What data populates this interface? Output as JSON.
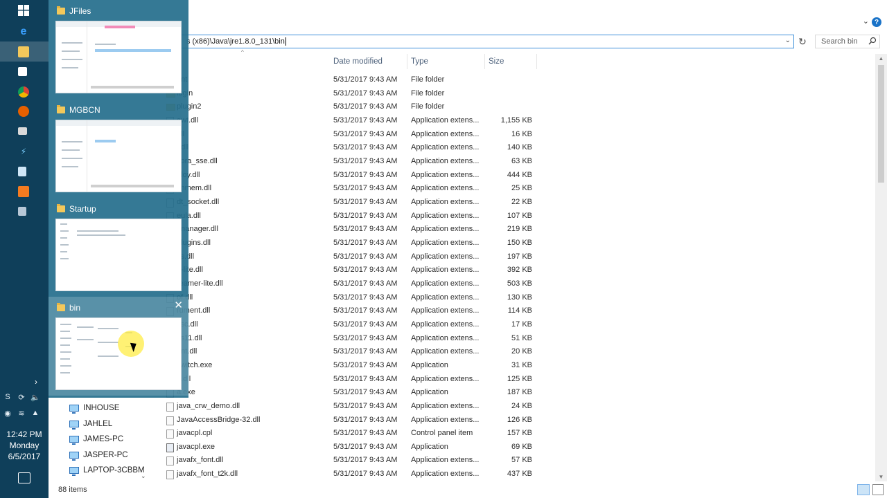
{
  "taskbar": {
    "icons": [
      "windows-start-icon",
      "edge-icon",
      "file-explorer-icon",
      "store-icon",
      "chrome-icon",
      "firefox-icon",
      "terminal-icon",
      "app-icon",
      "notepad-icon",
      "office-icon",
      "tool-icon"
    ],
    "clock": {
      "time": "12:42 PM",
      "day": "Monday",
      "date": "6/5/2017"
    }
  },
  "switcher": {
    "windows": [
      {
        "title": "JFiles"
      },
      {
        "title": "MGBCN"
      },
      {
        "title": "Startup"
      },
      {
        "title": "bin"
      }
    ],
    "close_glyph": "✕"
  },
  "explorer": {
    "address": "s (x86)\\Java\\jre1.8.0_131\\bin",
    "search_placeholder": "Search bin",
    "columns": {
      "date": "Date modified",
      "type": "Type",
      "size": "Size"
    },
    "files": [
      {
        "name": "ent",
        "date": "5/31/2017 9:43 AM",
        "type": "File folder",
        "size": ""
      },
      {
        "name": "lugin",
        "date": "5/31/2017 9:43 AM",
        "type": "File folder",
        "size": ""
      },
      {
        "name": "plugin2",
        "date": "5/31/2017 9:43 AM",
        "type": "File folder",
        "size": ""
      },
      {
        "name": "awt.dll",
        "date": "5/31/2017 9:43 AM",
        "type": "Application extens...",
        "size": "1,155 KB"
      },
      {
        "name": "dll",
        "date": "5/31/2017 9:43 AM",
        "type": "Application extens...",
        "size": "16 KB"
      },
      {
        "name": "r.dll",
        "date": "5/31/2017 9:43 AM",
        "type": "Application extens...",
        "size": "140 KB"
      },
      {
        "name": "cora_sse.dll",
        "date": "5/31/2017 9:43 AM",
        "type": "Application extens...",
        "size": "63 KB"
      },
      {
        "name": "ploy.dll",
        "date": "5/31/2017 9:43 AM",
        "type": "Application extens...",
        "size": "444 KB"
      },
      {
        "name": "shmem.dll",
        "date": "5/31/2017 9:43 AM",
        "type": "Application extens...",
        "size": "25 KB"
      },
      {
        "name": "dt_socket.dll",
        "date": "5/31/2017 9:43 AM",
        "type": "Application extens...",
        "size": "22 KB"
      },
      {
        "name": "eula.dll",
        "date": "5/31/2017 9:43 AM",
        "type": "Application extens...",
        "size": "107 KB"
      },
      {
        "name": "tmanager.dll",
        "date": "5/31/2017 9:43 AM",
        "type": "Application extens...",
        "size": "219 KB"
      },
      {
        "name": "plugins.dll",
        "date": "5/31/2017 9:43 AM",
        "type": "Application extens...",
        "size": "150 KB"
      },
      {
        "name": "ss.dll",
        "date": "5/31/2017 9:43 AM",
        "type": "Application extens...",
        "size": "197 KB"
      },
      {
        "name": "o-lite.dll",
        "date": "5/31/2017 9:43 AM",
        "type": "Application extens...",
        "size": "392 KB"
      },
      {
        "name": "reamer-lite.dll",
        "date": "5/31/2017 9:43 AM",
        "type": "Application extens...",
        "size": "503 KB"
      },
      {
        "name": "of.dll",
        "date": "5/31/2017 9:43 AM",
        "type": "Application extens...",
        "size": "130 KB"
      },
      {
        "name": "rument.dll",
        "date": "5/31/2017 9:43 AM",
        "type": "Application extens...",
        "size": "114 KB"
      },
      {
        "name": "csc.dll",
        "date": "5/31/2017 9:43 AM",
        "type": "Application extens...",
        "size": "17 KB"
      },
      {
        "name": "cs11.dll",
        "date": "5/31/2017 9:43 AM",
        "type": "Application extens...",
        "size": "51 KB"
      },
      {
        "name": "_nt.dll",
        "date": "5/31/2017 9:43 AM",
        "type": "Application extens...",
        "size": "20 KB"
      },
      {
        "name": "switch.exe",
        "date": "5/31/2017 9:43 AM",
        "type": "Application",
        "size": "31 KB"
      },
      {
        "name": "a.dll",
        "date": "5/31/2017 9:43 AM",
        "type": "Application extens...",
        "size": "125 KB"
      },
      {
        "name": "a.exe",
        "date": "5/31/2017 9:43 AM",
        "type": "Application",
        "size": "187 KB"
      },
      {
        "name": "java_crw_demo.dll",
        "date": "5/31/2017 9:43 AM",
        "type": "Application extens...",
        "size": "24 KB"
      },
      {
        "name": "JavaAccessBridge-32.dll",
        "date": "5/31/2017 9:43 AM",
        "type": "Application extens...",
        "size": "126 KB"
      },
      {
        "name": "javacpl.cpl",
        "date": "5/31/2017 9:43 AM",
        "type": "Control panel item",
        "size": "157 KB"
      },
      {
        "name": "javacpl.exe",
        "date": "5/31/2017 9:43 AM",
        "type": "Application",
        "size": "69 KB"
      },
      {
        "name": "javafx_font.dll",
        "date": "5/31/2017 9:43 AM",
        "type": "Application extens...",
        "size": "57 KB"
      },
      {
        "name": "javafx_font_t2k.dll",
        "date": "5/31/2017 9:43 AM",
        "type": "Application extens...",
        "size": "437 KB"
      }
    ],
    "nav_items": [
      "INHOUSE",
      "JAHLEL",
      "JAMES-PC",
      "JASPER-PC",
      "LAPTOP-3CBBM"
    ],
    "status": "88 items"
  }
}
